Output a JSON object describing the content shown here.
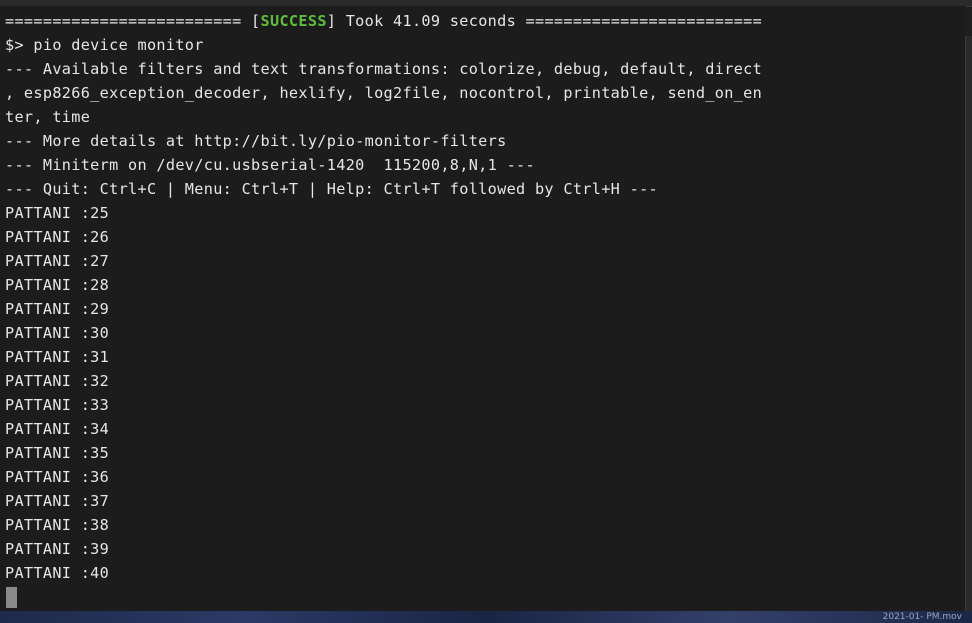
{
  "header_line": {
    "prefix": "========================= [",
    "status": "SUCCESS",
    "suffix": "] Took 41.09 seconds =========================",
    "status_color": "#5fbf3a"
  },
  "lines": [
    "$> pio device monitor",
    "--- Available filters and text transformations: colorize, debug, default, direct",
    ", esp8266_exception_decoder, hexlify, log2file, nocontrol, printable, send_on_en",
    "ter, time",
    "--- More details at http://bit.ly/pio-monitor-filters",
    "--- Miniterm on /dev/cu.usbserial-1420  115200,8,N,1 ---",
    "--- Quit: Ctrl+C | Menu: Ctrl+T | Help: Ctrl+T followed by Ctrl+H ---",
    "PATTANI :25",
    "PATTANI :26",
    "PATTANI :27",
    "PATTANI :28",
    "PATTANI :29",
    "PATTANI :30",
    "PATTANI :31",
    "PATTANI :32",
    "PATTANI :33",
    "PATTANI :34",
    "PATTANI :35",
    "PATTANI :36",
    "PATTANI :37",
    "PATTANI :38",
    "PATTANI :39",
    "PATTANI :40"
  ],
  "desktop_text": "2021-01-  PM.mov"
}
